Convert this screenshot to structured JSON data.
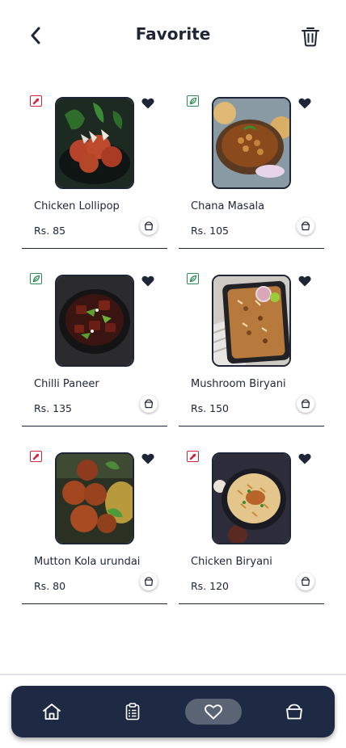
{
  "header": {
    "title": "Favorite",
    "back_icon": "chevron-left-icon",
    "delete_icon": "trash-icon"
  },
  "colors": {
    "primary": "#1e2537",
    "navbar": "#1e2a44",
    "nav_active": "#5b6475",
    "veg": "#2e8b57",
    "nonveg": "#d0223a"
  },
  "favorites": [
    {
      "name": "Chicken Lollipop",
      "price": "Rs. 85",
      "type": "nonveg"
    },
    {
      "name": "Chana Masala",
      "price": "Rs. 105",
      "type": "veg"
    },
    {
      "name": "Chilli Paneer",
      "price": "Rs. 135",
      "type": "veg"
    },
    {
      "name": "Mushroom Biryani",
      "price": "Rs. 150",
      "type": "veg"
    },
    {
      "name": "Mutton Kola urundai",
      "price": "Rs. 80",
      "type": "nonveg"
    },
    {
      "name": "Chicken Biryani",
      "price": "Rs. 120",
      "type": "nonveg"
    }
  ],
  "nav": {
    "items": [
      {
        "icon": "home-icon",
        "active": false
      },
      {
        "icon": "clipboard-list-icon",
        "active": false
      },
      {
        "icon": "heart-icon",
        "active": true
      },
      {
        "icon": "shopping-bag-icon",
        "active": false
      }
    ]
  }
}
